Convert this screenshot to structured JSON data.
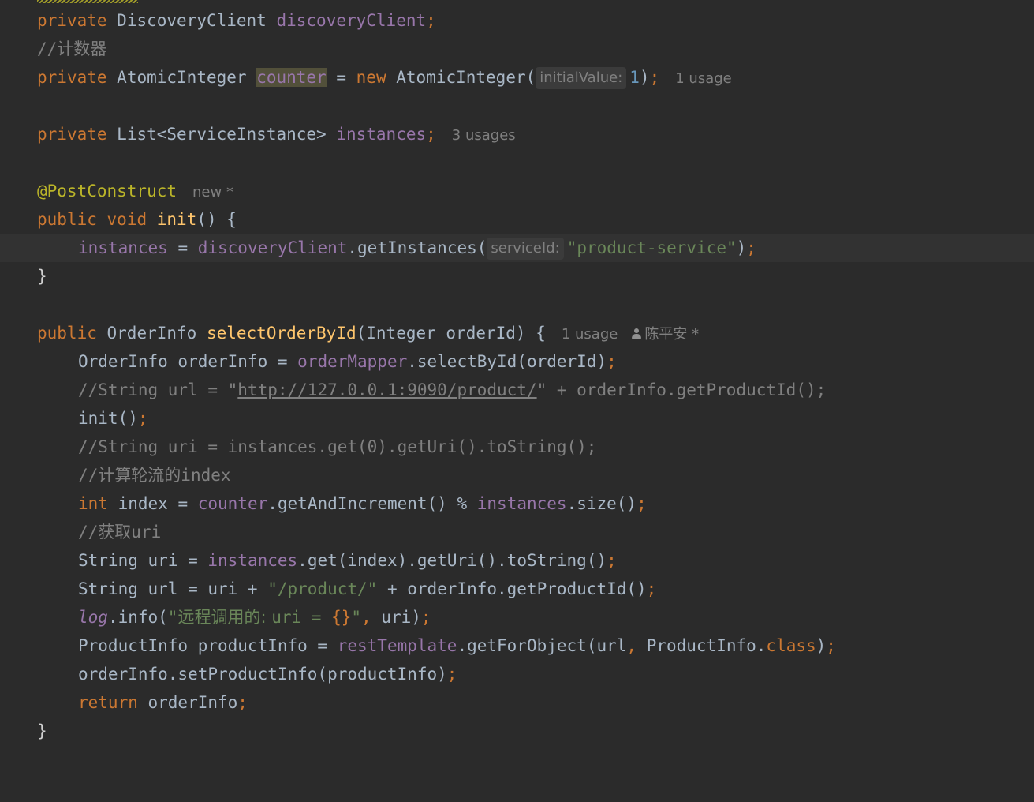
{
  "code": {
    "line1": {
      "kw": "private",
      "type": "DiscoveryClient",
      "field": "discoveryClient",
      "semi": ";"
    },
    "line2": {
      "comment_prefix": "//",
      "comment_text": "计数器"
    },
    "line3": {
      "kw": "private",
      "type": "AtomicInteger",
      "field": "counter",
      "eq": " = ",
      "kw_new": "new",
      "call": "AtomicInteger(",
      "param_hint": "initialValue:",
      "num": "1",
      "close": ")",
      "semi": ";",
      "usage": "1 usage"
    },
    "line5": {
      "kw": "private",
      "type": "List<ServiceInstance>",
      "field": "instances",
      "semi": ";",
      "usage": "3 usages"
    },
    "line7": {
      "annotation": "@PostConstruct",
      "marker": "new *"
    },
    "line8": {
      "kw1": "public",
      "kw2": "void",
      "method": "init",
      "rest": "() {"
    },
    "line9": {
      "field": "instances",
      "eq": " = ",
      "field2": "discoveryClient",
      "call": ".getInstances(",
      "param_hint": "serviceId:",
      "str": "\"product-service\"",
      "close": ")",
      "semi": ";"
    },
    "line10": {
      "brace": "}"
    },
    "line12": {
      "kw": "public",
      "type": "OrderInfo",
      "method": "selectOrderById",
      "params": "(Integer orderId) {",
      "usage": "1 usage",
      "author": "陈平安 *"
    },
    "line13": {
      "text": "OrderInfo orderInfo = ",
      "field": "orderMapper",
      "call": ".selectById(orderId)",
      "semi": ";"
    },
    "line14": {
      "prefix": "//String url = \"",
      "url": "http://127.0.0.1:9090/product/",
      "suffix": "\" + orderInfo.getProductId();"
    },
    "line15": {
      "text": "init()",
      "semi": ";"
    },
    "line16": {
      "comment": "//String uri = instances.get(0).getUri().toString();"
    },
    "line17": {
      "comment_prefix": "//",
      "comment_cjk": "计算轮流的",
      "comment_suffix": "index"
    },
    "line18": {
      "kw": "int",
      "text": " index = ",
      "field": "counter",
      "call": ".getAndIncrement() % ",
      "field2": "instances",
      "call2": ".size()",
      "semi": ";"
    },
    "line19": {
      "comment_prefix": "//",
      "comment_cjk": "获取",
      "comment_suffix": "uri"
    },
    "line20": {
      "text": "String uri = ",
      "field": "instances",
      "call": ".get(index).getUri().toString()",
      "semi": ";"
    },
    "line21": {
      "text": "String url = uri + ",
      "str": "\"/product/\"",
      "call": " + orderInfo.getProductId()",
      "semi": ";"
    },
    "line22": {
      "log": "log",
      "call": ".info(",
      "str_open": "\"",
      "str_cjk": "远程调用的: ",
      "str_rest": "uri = ",
      "placeholder": "{}",
      "str_close": "\"",
      "comma": ",",
      "arg": " uri)",
      "semi": ";"
    },
    "line23": {
      "text": "ProductInfo productInfo = ",
      "field": "restTemplate",
      "call": ".getForObject(url",
      "comma": ",",
      "arg": " ProductInfo.",
      "kw": "class",
      "close": ")",
      "semi": ";"
    },
    "line24": {
      "text": "orderInfo.setProductInfo(productInfo)",
      "semi": ";"
    },
    "line25": {
      "kw": "return",
      "text": " orderInfo",
      "semi": ";"
    },
    "line26": {
      "brace": "}"
    }
  },
  "colors": {
    "background": "#2b2b2b",
    "current_line": "#323232",
    "keyword": "#cc7832",
    "field": "#9876aa",
    "comment": "#808080",
    "string": "#6a8759",
    "number": "#6897bb",
    "method_decl": "#ffc66d",
    "annotation": "#bbb529",
    "text": "#a9b7c6"
  }
}
